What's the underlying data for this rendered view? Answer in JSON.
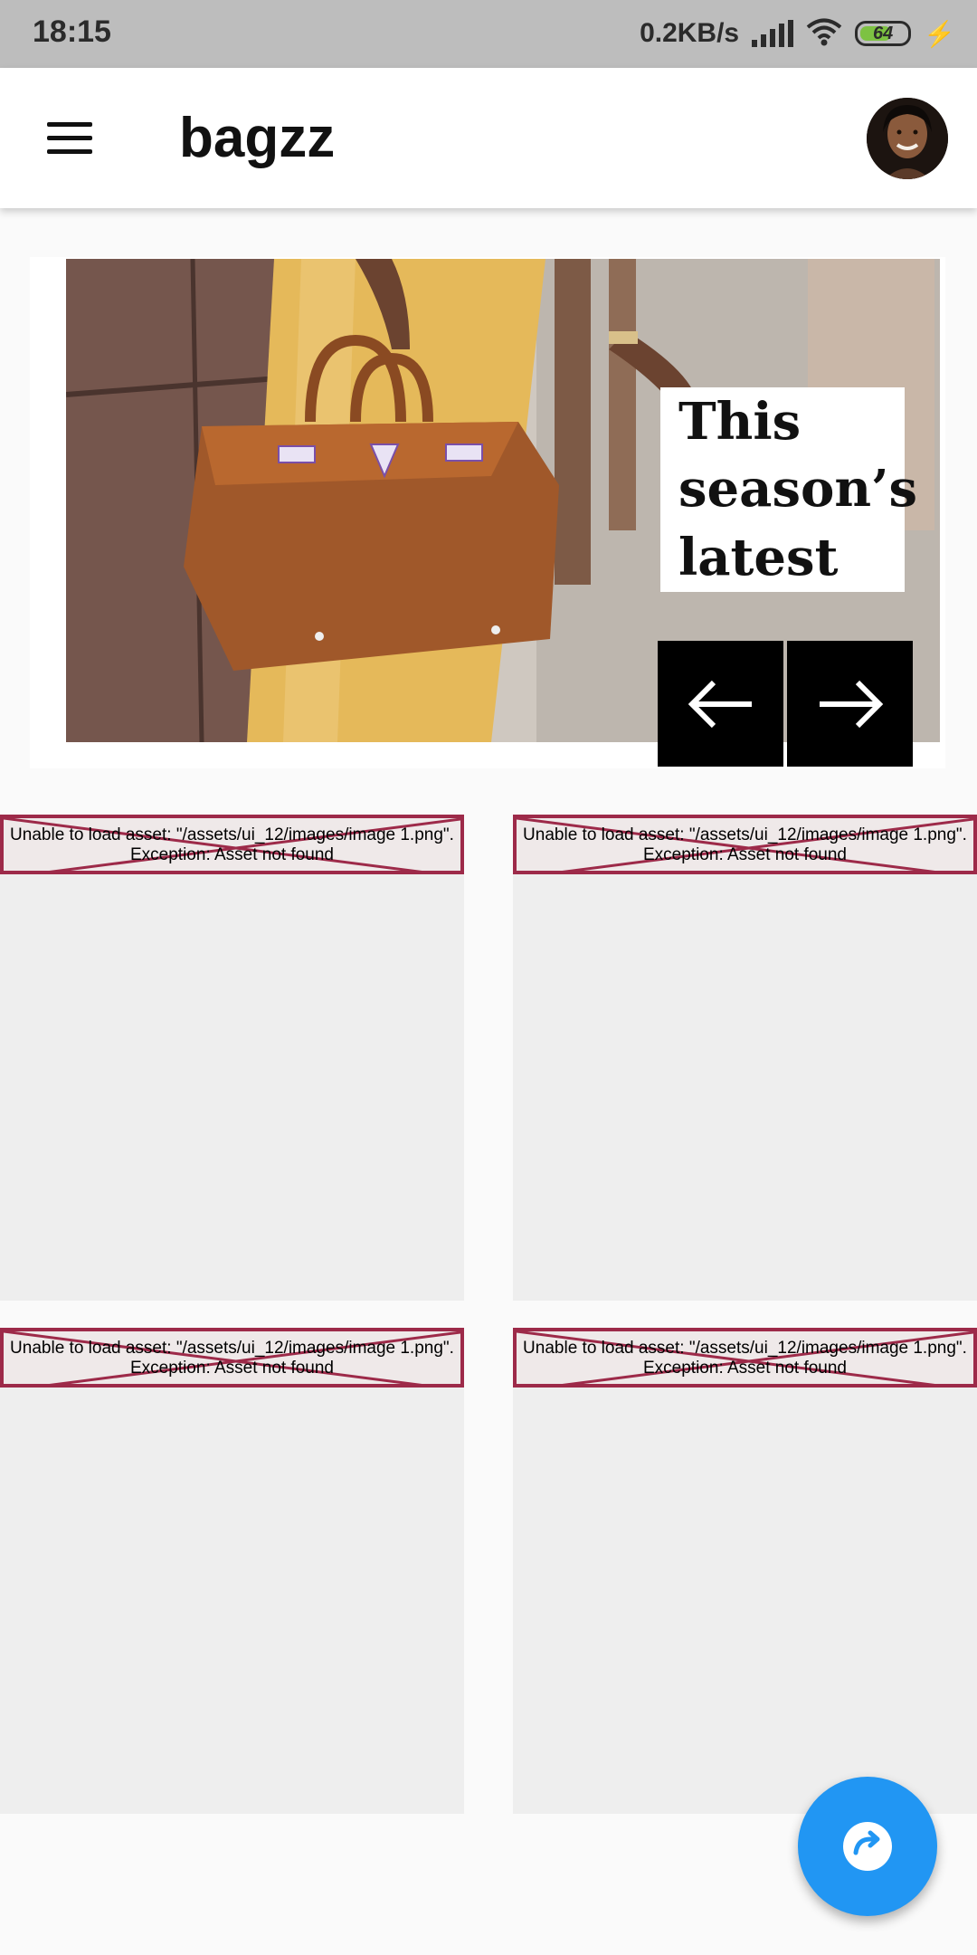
{
  "status_bar": {
    "time": "18:15",
    "network_speed": "0.2KB/s",
    "battery_level": "64",
    "icons": [
      "signal-icon",
      "wifi-icon",
      "battery-icon",
      "charging-bolt-icon"
    ]
  },
  "app_bar": {
    "title": "bagzz",
    "menu_icon": "menu-icon",
    "avatar": "user-avatar"
  },
  "hero": {
    "caption_lines": [
      "This",
      "season’s",
      "latest"
    ],
    "prev_icon": "arrow-left-icon",
    "next_icon": "arrow-right-icon"
  },
  "products": [
    {
      "error_text": "Unable to load asset: \"/assets/ui_12/images/image 1.png\".\nException: Asset not found"
    },
    {
      "error_text": "Unable to load asset: \"/assets/ui_12/images/image 1.png\".\nException: Asset not found"
    },
    {
      "error_text": "Unable to load asset: \"/assets/ui_12/images/image 1.png\".\nException: Asset not found"
    },
    {
      "error_text": "Unable to load asset: \"/assets/ui_12/images/image 1.png\".\nException: Asset not found"
    }
  ],
  "fab": {
    "icon": "redo-icon"
  },
  "colors": {
    "status_bar": "#bdbdbd",
    "fab": "#2196f3",
    "error_border": "#9d2a49",
    "card": "#eeeeee"
  }
}
